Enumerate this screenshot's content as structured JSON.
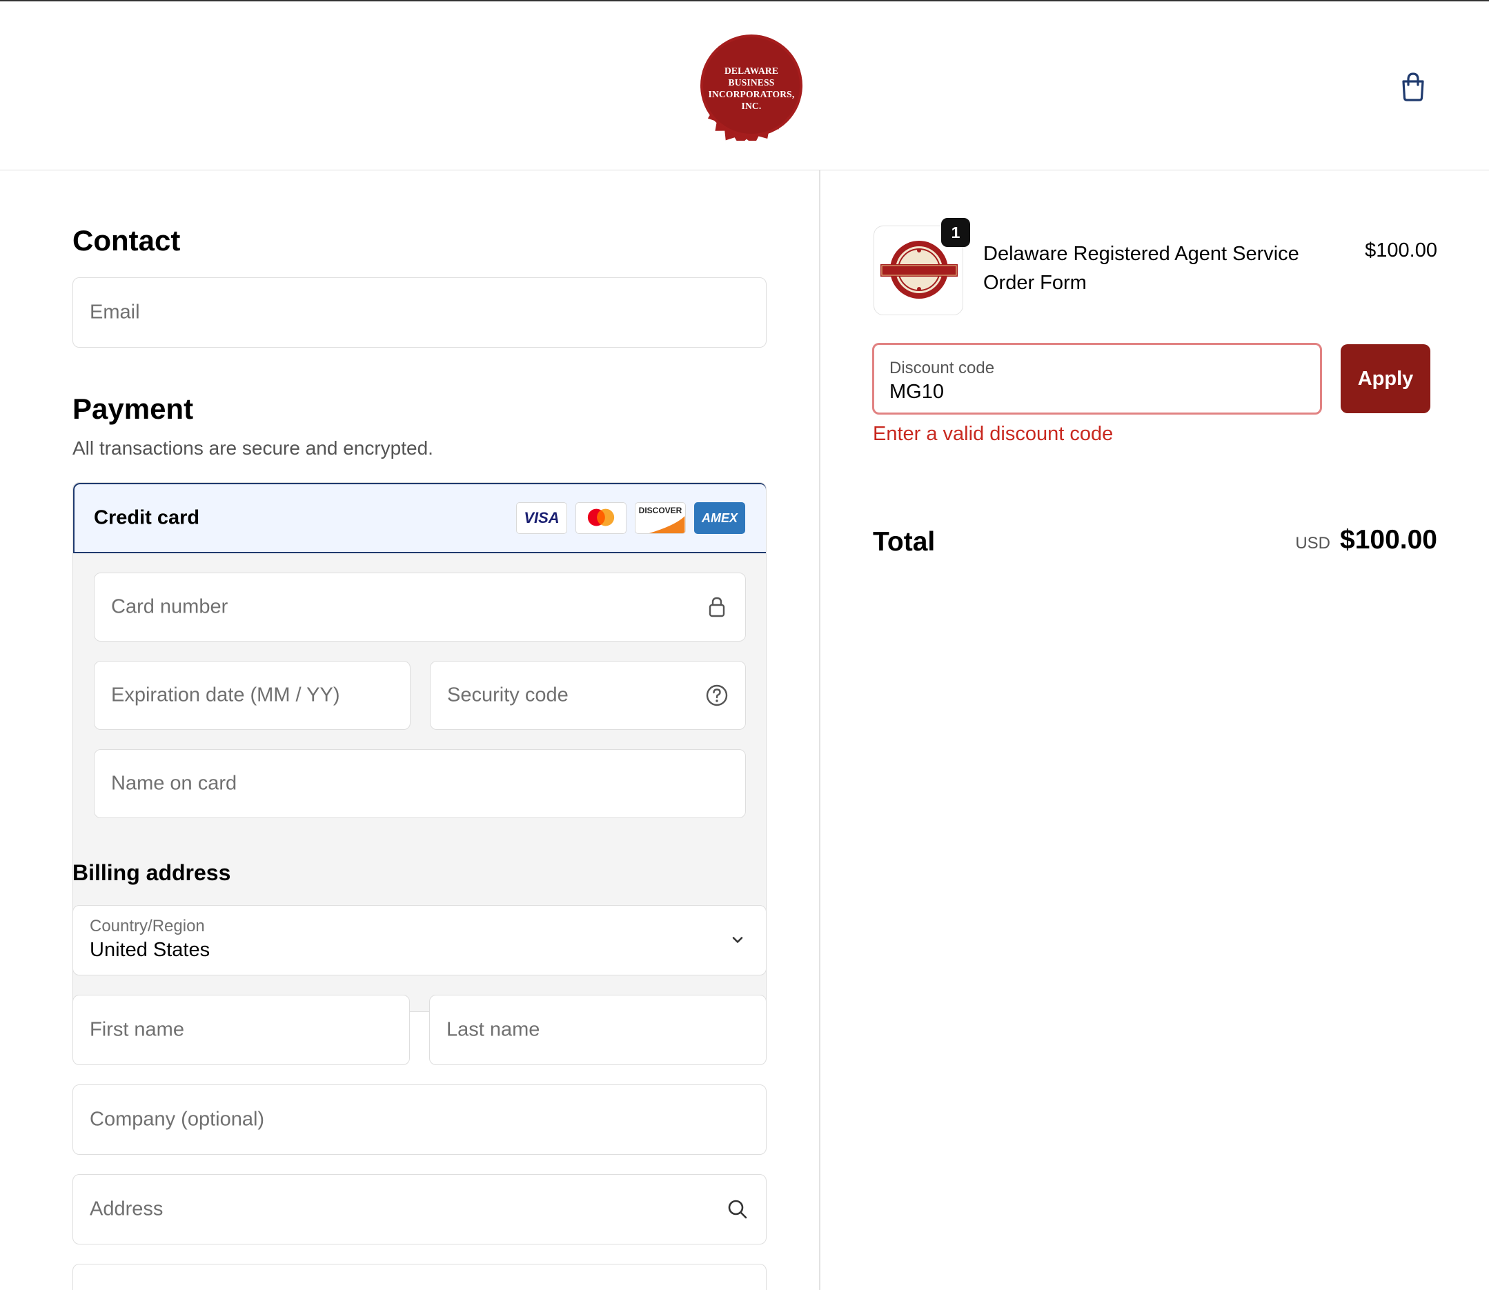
{
  "brand": {
    "logo_lines": [
      "DELAWARE",
      "BUSINESS",
      "INCORPORATORS,",
      "INC."
    ],
    "accent": "#8c1b16",
    "error_color": "#c8281f",
    "selected_border": "#1f3a6e"
  },
  "header": {
    "cart_icon": "shopping-bag-icon"
  },
  "contact": {
    "title": "Contact",
    "email_placeholder": "Email"
  },
  "payment": {
    "title": "Payment",
    "subtitle": "All transactions are secure and encrypted.",
    "method_label": "Credit card",
    "card_brands": [
      "VISA",
      "DISCOVER",
      "AMEX"
    ],
    "card_number_placeholder": "Card number",
    "expiration_placeholder": "Expiration date (MM / YY)",
    "security_placeholder": "Security code",
    "name_placeholder": "Name on card"
  },
  "billing": {
    "title": "Billing address",
    "country_label": "Country/Region",
    "country_value": "United States",
    "first_name_placeholder": "First name",
    "last_name_placeholder": "Last name",
    "company_placeholder": "Company (optional)",
    "address_placeholder": "Address"
  },
  "order": {
    "item_title": "Delaware Registered Agent Service Order Form",
    "item_price": "$100.00",
    "quantity": "1",
    "discount_label": "Discount code",
    "discount_value": "MG10",
    "apply_label": "Apply",
    "discount_error": "Enter a valid discount code",
    "total_label": "Total",
    "currency": "USD",
    "total_value": "$100.00"
  }
}
